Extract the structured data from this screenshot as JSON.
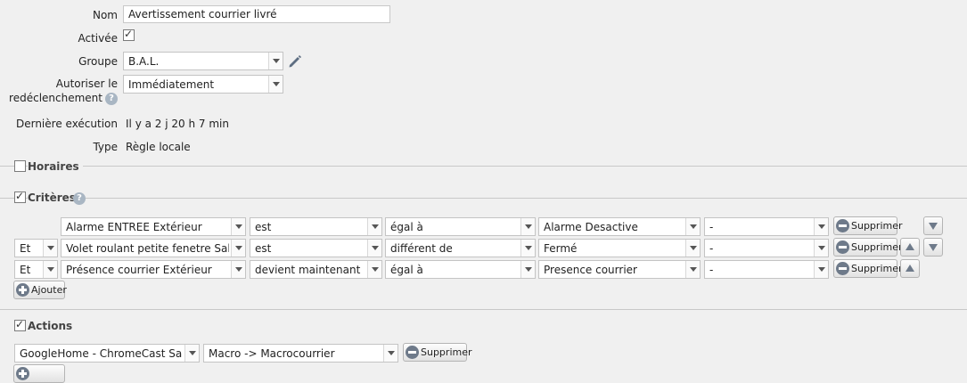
{
  "form": {
    "nom": {
      "label": "Nom",
      "value": "Avertissement courrier livré"
    },
    "activee": {
      "label": "Activée",
      "checked": true
    },
    "groupe": {
      "label": "Groupe",
      "value": "B.A.L."
    },
    "autoriser": {
      "label_line1": "Autoriser le",
      "label_line2": "redéclenchement",
      "value": "Immédiatement"
    },
    "derniere": {
      "label": "Dernière exécution",
      "value": "Il y a 2 j 20 h 7 min"
    },
    "type": {
      "label": "Type",
      "value": "Règle locale"
    }
  },
  "sections": {
    "horaires": {
      "title": "Horaires",
      "checked": false
    },
    "criteres": {
      "title": "Critères",
      "checked": true
    },
    "actions": {
      "title": "Actions",
      "checked": true
    }
  },
  "criteria": [
    {
      "conj": "",
      "device": "Alarme ENTREE Extérieur",
      "verb": "est",
      "op": "égal à",
      "value": "Alarme Desactive",
      "extra": "-"
    },
    {
      "conj": "Et",
      "device": "Volet roulant petite fenetre Salon",
      "verb": "est",
      "op": "différent de",
      "value": "Fermé",
      "extra": "-"
    },
    {
      "conj": "Et",
      "device": "Présence courrier Extérieur",
      "verb": "devient maintenant",
      "op": "égal à",
      "value": "Presence courrier",
      "extra": "-"
    }
  ],
  "buttons": {
    "supprimer": "Supprimer",
    "ajouter": "Ajouter"
  },
  "actions": [
    {
      "target": "GoogleHome - ChromeCast Salle à",
      "command": "Macro -> Macrocourrier"
    }
  ],
  "icons": {
    "edit": "pencil-icon",
    "help": "help-icon"
  },
  "colors": {
    "background": "#f0f0f0",
    "icon": "#6e7a8a"
  }
}
